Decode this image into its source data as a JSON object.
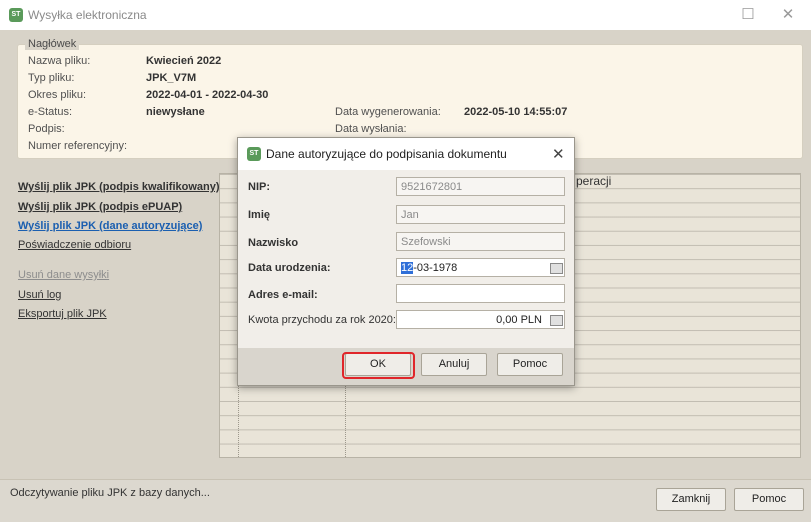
{
  "window": {
    "title": "Wysyłka elektroniczna",
    "app_icon_text": "ST",
    "minimize_icon": "minimize-icon",
    "maximize_icon": "maximize-icon"
  },
  "header": {
    "legend": "Nagłówek",
    "fields": [
      {
        "label": "Nazwa pliku:",
        "value": "Kwiecień 2022"
      },
      {
        "label": "Typ pliku:",
        "value": "JPK_V7M"
      },
      {
        "label": "Okres pliku:",
        "value": "2022-04-01 - 2022-04-30"
      },
      {
        "label": "e-Status:",
        "value": "niewysłane"
      },
      {
        "label": "Podpis:",
        "value": ""
      },
      {
        "label": "Numer referencyjny:",
        "value": ""
      }
    ],
    "right_fields": [
      {
        "label": "Data wygenerowania:",
        "value": "2022-05-10 14:55:07"
      },
      {
        "label": "Data wysłania:",
        "value": ""
      }
    ]
  },
  "actions": [
    {
      "label": "Wyślij plik JPK (podpis kwalifikowany)",
      "style": "bold"
    },
    {
      "label": "Wyślij plik JPK (podpis ePUAP)",
      "style": "bold"
    },
    {
      "label": "Wyślij plik JPK (dane autoryzujące)",
      "style": "blue"
    },
    {
      "label": "Poświadczenie odbioru",
      "style": "normal"
    },
    {
      "label": "Usuń dane wysyłki",
      "style": "dim"
    },
    {
      "label": "Usuń log",
      "style": "normal"
    },
    {
      "label": "Eksportuj plik JPK",
      "style": "normal"
    }
  ],
  "grid": {
    "header_fragment": "peracji"
  },
  "status": {
    "text": "Odczytywanie pliku JPK z bazy danych...",
    "close_button": "Zamknij",
    "help_button": "Pomoc"
  },
  "dialog": {
    "title": "Dane autoryzujące do podpisania dokumentu",
    "close_icon": "close-icon",
    "nip_label": "NIP:",
    "nip_value": "9521672801",
    "first_name_label": "Imię",
    "first_name_value": "Jan",
    "last_name_label": "Nazwisko",
    "last_name_value": "Szefowski",
    "birth_label": "Data urodzenia:",
    "birth_value_selected": "12",
    "birth_value_rest": "-03-1978",
    "email_label": "Adres e-mail:",
    "email_value": "",
    "income_label": "Kwota przychodu za rok 2020:",
    "income_value": "0,00 PLN",
    "ok_button": "OK",
    "cancel_button": "Anuluj",
    "help_button": "Pomoc",
    "highlight_color": "#e0262a"
  }
}
